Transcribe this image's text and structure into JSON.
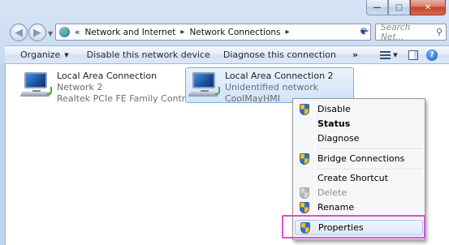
{
  "window": {
    "caption": {
      "minimize": "—",
      "maximize": "▢",
      "close": "✕"
    }
  },
  "address": {
    "prefix": "«",
    "crumbs": [
      "Network and Internet",
      "Network Connections"
    ],
    "separator": "▸",
    "search_placeholder": "Search Net..."
  },
  "toolbar": {
    "organize": "Organize",
    "disable": "Disable this network device",
    "diagnose": "Diagnose this connection",
    "more": "»"
  },
  "connections": [
    {
      "name": "Local Area Connection",
      "line2": "Network  2",
      "line3": "Realtek PCIe FE Family Controller",
      "status_icon": "ok",
      "selected": false
    },
    {
      "name": "Local Area Connection 2",
      "line2": "Unidentified network",
      "line3": "CoolMayHMI",
      "status_icon": "ok",
      "selected": true
    }
  ],
  "context_menu": {
    "items": [
      {
        "label": "Disable",
        "icon": "shield-icon",
        "bold": false,
        "disabled": false
      },
      {
        "label": "Status",
        "icon": "",
        "bold": true,
        "disabled": false
      },
      {
        "label": "Diagnose",
        "icon": "",
        "bold": false,
        "disabled": false
      },
      {
        "label": "Bridge Connections",
        "icon": "shield-icon",
        "bold": false,
        "disabled": false
      },
      {
        "label": "Create Shortcut",
        "icon": "",
        "bold": false,
        "disabled": false
      },
      {
        "label": "Delete",
        "icon": "shield-icon",
        "bold": false,
        "disabled": true
      },
      {
        "label": "Rename",
        "icon": "shield-icon",
        "bold": false,
        "disabled": false
      },
      {
        "label": "Properties",
        "icon": "shield-icon",
        "bold": false,
        "disabled": false
      }
    ]
  },
  "colors": {
    "highlight_box": "#d94fd4",
    "selection_fill": "#cfe3fa"
  }
}
